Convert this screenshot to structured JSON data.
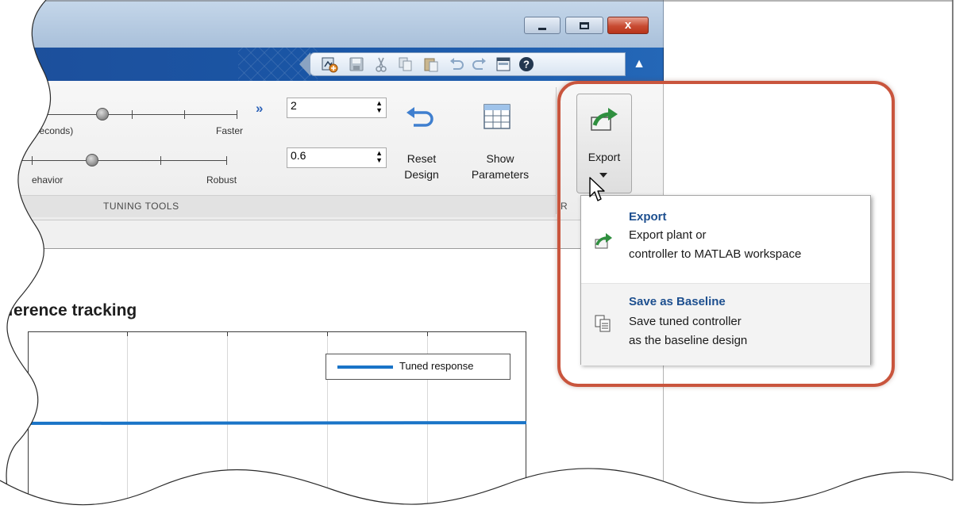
{
  "window": {
    "buttons": {
      "minimize": "minimize",
      "maximize": "maximize",
      "close": "x"
    }
  },
  "quick_access_toolbar": {
    "icons": [
      "new-figure-icon",
      "save-icon",
      "cut-icon",
      "copy-icon",
      "paste-icon",
      "undo-icon",
      "redo-icon",
      "window-layout-icon",
      "help-icon"
    ],
    "collapse_glyph": "▲"
  },
  "tuning_tools": {
    "group_label": "TUNING TOOLS",
    "response_time": {
      "left_label": "Time (seconds)",
      "right_label": "Faster",
      "value": "2",
      "knob_fraction": 0.4
    },
    "transient_behavior": {
      "left_label": "ehavior",
      "right_label": "Robust",
      "value": "0.6",
      "knob_fraction": 0.5
    },
    "more_glyph": "»",
    "reset_design": {
      "line1": "Reset",
      "line2": "Design"
    },
    "show_parameters": {
      "line1": "Show",
      "line2": "Parameters"
    }
  },
  "export_group": {
    "button_label": "Export",
    "group_label_fragment": "R"
  },
  "export_menu": {
    "items": [
      {
        "title": "Export",
        "desc_line1": "Export plant or",
        "desc_line2": "controller to MATLAB workspace",
        "icon": "export-icon"
      },
      {
        "title": "Save as Baseline",
        "desc_line1": "Save tuned controller",
        "desc_line2": "as the baseline design",
        "icon": "copy-icon"
      }
    ]
  },
  "plot": {
    "title": "ference tracking",
    "legend": {
      "entry": "Tuned response",
      "color": "#1a74c7"
    }
  },
  "colors": {
    "highlight": "#c9553d",
    "ribbon_blue": "#1a56a6",
    "menu_title": "#1d4f8f"
  }
}
